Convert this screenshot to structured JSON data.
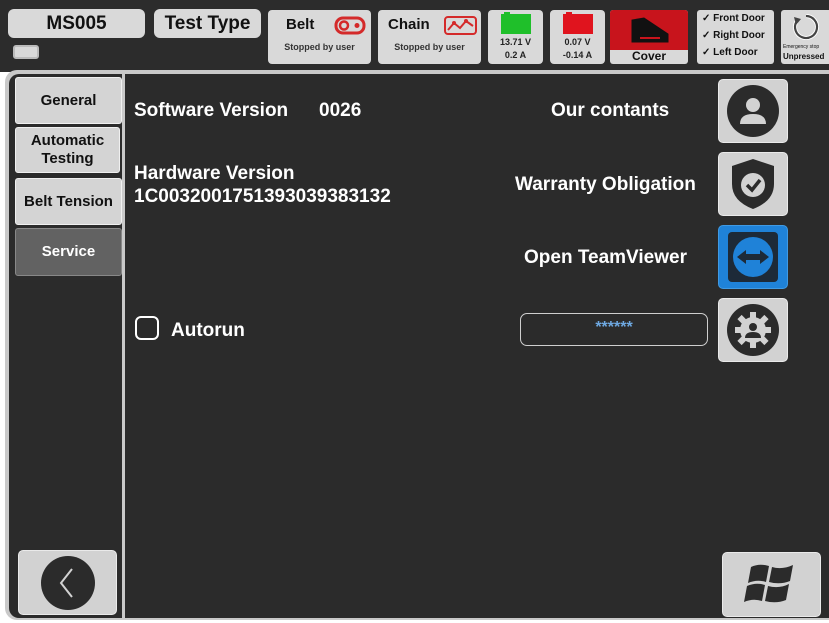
{
  "header": {
    "device_name": "MS005",
    "test_type_label": "Test Type",
    "belt": {
      "title": "Belt",
      "status": "Stopped by user",
      "icon": "belt-motor-icon"
    },
    "chain": {
      "title": "Chain",
      "status": "Stopped by user",
      "icon": "chain-icon"
    },
    "battery_1": {
      "voltage": "13.71 V",
      "current": "0.2 A",
      "color": "#1fbf2a"
    },
    "battery_2": {
      "voltage": "0.07 V",
      "current": "-0.14 A",
      "color": "#e0141e"
    },
    "cover": {
      "label": "Cover",
      "color": "#c8141c"
    },
    "doors": [
      "✓ Front Door",
      "✓ Right Door",
      "✓ Left Door"
    ],
    "emergency": {
      "title": "Emergency stop",
      "status": "Unpressed"
    }
  },
  "sidebar": {
    "tabs": [
      {
        "label": "General"
      },
      {
        "label": "Automatic Testing"
      },
      {
        "label": "Belt Tension"
      },
      {
        "label": "Service",
        "active": true
      }
    ]
  },
  "main": {
    "software_label": "Software Version",
    "software_value": "0026",
    "hardware_label": "Hardware Version",
    "hardware_value": "1C0032001751393039383132",
    "autorun_label": "Autorun",
    "password_value": "******",
    "actions": [
      {
        "label": "Our contants",
        "icon": "contact-icon"
      },
      {
        "label": "Warranty Obligation",
        "icon": "warranty-shield-icon"
      },
      {
        "label": "Open TeamViewer",
        "icon": "teamviewer-icon"
      },
      {
        "icon": "service-settings-icon"
      }
    ]
  },
  "colors": {
    "panel": "#2b2b2b",
    "accent_blue": "#1f82d8",
    "active_tab": "#626262"
  }
}
